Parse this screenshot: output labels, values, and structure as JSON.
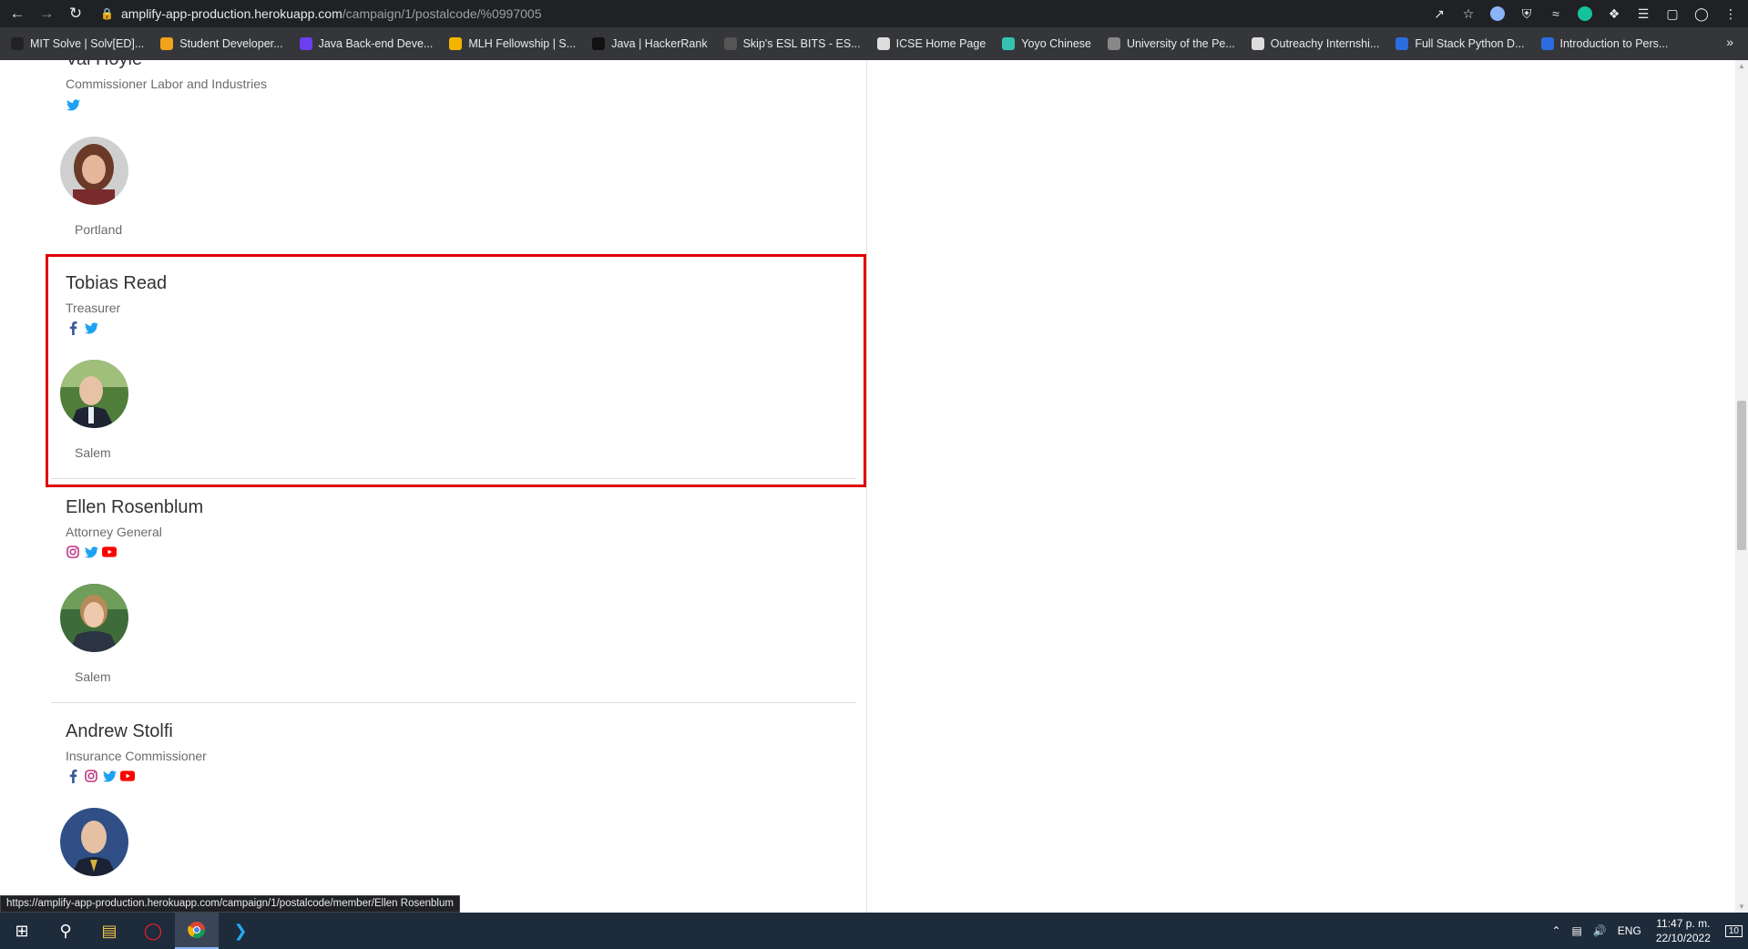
{
  "browser": {
    "url_host": "amplify-app-production.herokuapp.com",
    "url_path": "/campaign/1/postalcode/%0997005",
    "bookmarks": [
      {
        "label": "MIT Solve | Solv[ED]...",
        "color": "#222222"
      },
      {
        "label": "Student Developer...",
        "color": "#f0a21a"
      },
      {
        "label": "Java Back-end Deve...",
        "color": "#6b3ef0"
      },
      {
        "label": "MLH Fellowship | S...",
        "color": "#f5b400"
      },
      {
        "label": "Java | HackerRank",
        "color": "#111111"
      },
      {
        "label": "Skip's ESL BITS - ES...",
        "color": "#555555"
      },
      {
        "label": "ICSE Home Page",
        "color": "#dddddd"
      },
      {
        "label": "Yoyo Chinese",
        "color": "#33c3b0"
      },
      {
        "label": "University of the Pe...",
        "color": "#888888"
      },
      {
        "label": "Outreachy Internshi...",
        "color": "#dddddd"
      },
      {
        "label": "Full Stack Python D...",
        "color": "#2b6de0"
      },
      {
        "label": "Introduction to Pers...",
        "color": "#2b6de0"
      }
    ],
    "more_bookmarks": "»",
    "status_url": "https://amplify-app-production.herokuapp.com/campaign/1/postalcode/member/Ellen Rosenblum"
  },
  "members": [
    {
      "name": "Val Hoyle",
      "role": "Commissioner Labor and Industries",
      "city": "Portland",
      "socials": [
        "twitter"
      ]
    },
    {
      "name": "Tobias Read",
      "role": "Treasurer",
      "city": "Salem",
      "socials": [
        "facebook",
        "twitter"
      ]
    },
    {
      "name": "Ellen Rosenblum",
      "role": "Attorney General",
      "city": "Salem",
      "socials": [
        "instagram",
        "twitter",
        "youtube"
      ]
    },
    {
      "name": "Andrew Stolfi",
      "role": "Insurance Commissioner",
      "city": "",
      "socials": [
        "facebook",
        "instagram",
        "twitter",
        "youtube"
      ]
    }
  ],
  "taskbar": {
    "language": "ENG",
    "time": "11:47 p. m.",
    "date": "22/10/2022",
    "notifications": "10"
  },
  "colors": {
    "facebook": "#3b5998",
    "twitter": "#1da1f2",
    "instagram": "#c13584",
    "youtube": "#ff0000",
    "highlight": "#e00000"
  }
}
